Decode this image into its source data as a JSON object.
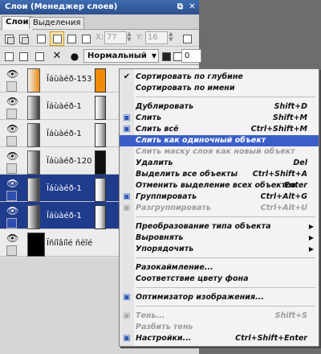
{
  "window": {
    "title": "Слои (Менеджер слоев)"
  },
  "tabs": [
    {
      "label": "Слои"
    },
    {
      "label": "Выделения"
    }
  ],
  "toolbar1": {
    "x_label": "X:",
    "x_value": "77",
    "y_label": "Y:",
    "y_value": "16"
  },
  "toolbar2": {
    "blend_mode": "Нормальный",
    "opacity": "0"
  },
  "layers": [
    {
      "name": "Ïáùàéð-153",
      "swatch": "#f08c0a",
      "thumb": "#e88a10",
      "selected": false
    },
    {
      "name": "Ïáùàéð-1",
      "swatch": "#cfcfcf",
      "thumb": "#3a3a3a",
      "selected": false
    },
    {
      "name": "Ïáùàéð-1",
      "swatch": "#cfcfcf",
      "thumb": "#3a3a3a",
      "selected": false
    },
    {
      "name": "Ïáùàéð-120",
      "swatch": "#111111",
      "thumb": "#3a3a3a",
      "selected": false
    },
    {
      "name": "Ïáùàéð-1",
      "swatch": "#e6e6e6",
      "thumb": "#3a3a3a",
      "selected": true
    },
    {
      "name": "Ïáùàéð-1",
      "swatch": "#e6e6e6",
      "thumb": "#3a3a3a",
      "selected": true
    },
    {
      "name": "Ïñíîâíîé ñëîé",
      "swatch": "#000000",
      "thumb": "#000000",
      "selected": false
    }
  ],
  "menu": {
    "items": [
      {
        "label": "Сортировать по глубине",
        "shortcut": "",
        "checked": true,
        "disabled": false,
        "highlight": false,
        "icon": "check-icon"
      },
      {
        "label": "Сортировать по имени",
        "shortcut": "",
        "disabled": false,
        "highlight": false
      },
      {
        "label": "Дублировать",
        "shortcut": "Shift+D",
        "disabled": false,
        "highlight": false
      },
      {
        "label": "Слить",
        "shortcut": "Shift+M",
        "disabled": false,
        "highlight": false,
        "icon": "merge-icon"
      },
      {
        "label": "Слить всё",
        "shortcut": "Ctrl+Shift+M",
        "disabled": false,
        "highlight": false,
        "icon": "merge-all-icon"
      },
      {
        "label": "Слить как одиночный объект",
        "shortcut": "",
        "disabled": false,
        "highlight": true
      },
      {
        "label": "Слить маску слоя как новый объект",
        "shortcut": "",
        "disabled": true,
        "highlight": false
      },
      {
        "label": "Удалить",
        "shortcut": "Del",
        "disabled": false,
        "highlight": false
      },
      {
        "label": "Выделить все объекты",
        "shortcut": "Ctrl+Shift+A",
        "disabled": false,
        "highlight": false
      },
      {
        "label": "Отменить выделение всех объектов",
        "shortcut": "Enter",
        "disabled": false,
        "highlight": false
      },
      {
        "label": "Группировать",
        "shortcut": "Ctrl+Alt+G",
        "disabled": false,
        "highlight": false,
        "icon": "group-icon"
      },
      {
        "label": "Разгруппировать",
        "shortcut": "Ctrl+Alt+U",
        "disabled": true,
        "highlight": false,
        "icon": "ungroup-icon"
      },
      {
        "label": "Преобразование типа объекта",
        "shortcut": "",
        "disabled": false,
        "highlight": false,
        "submenu": true
      },
      {
        "label": "Выровнять",
        "shortcut": "",
        "disabled": false,
        "highlight": false,
        "submenu": true
      },
      {
        "label": "Упорядочить",
        "shortcut": "",
        "disabled": false,
        "highlight": false,
        "submenu": true
      },
      {
        "label": "Разокаймление...",
        "shortcut": "",
        "disabled": false,
        "highlight": false
      },
      {
        "label": "Соответствие цвету фона",
        "shortcut": "",
        "disabled": false,
        "highlight": false
      },
      {
        "label": "Оптимизатор изображения...",
        "shortcut": "",
        "disabled": false,
        "highlight": false,
        "icon": "optimizer-icon"
      },
      {
        "label": "Тень...",
        "shortcut": "Shift+S",
        "disabled": true,
        "highlight": false,
        "icon": "shadow-icon"
      },
      {
        "label": "Разбить тень",
        "shortcut": "",
        "disabled": true,
        "highlight": false
      },
      {
        "label": "Настройки...",
        "shortcut": "Ctrl+Shift+Enter",
        "disabled": false,
        "highlight": false,
        "icon": "settings-icon"
      }
    ],
    "submenu_glyph": "▶",
    "check_glyph": "✔"
  }
}
